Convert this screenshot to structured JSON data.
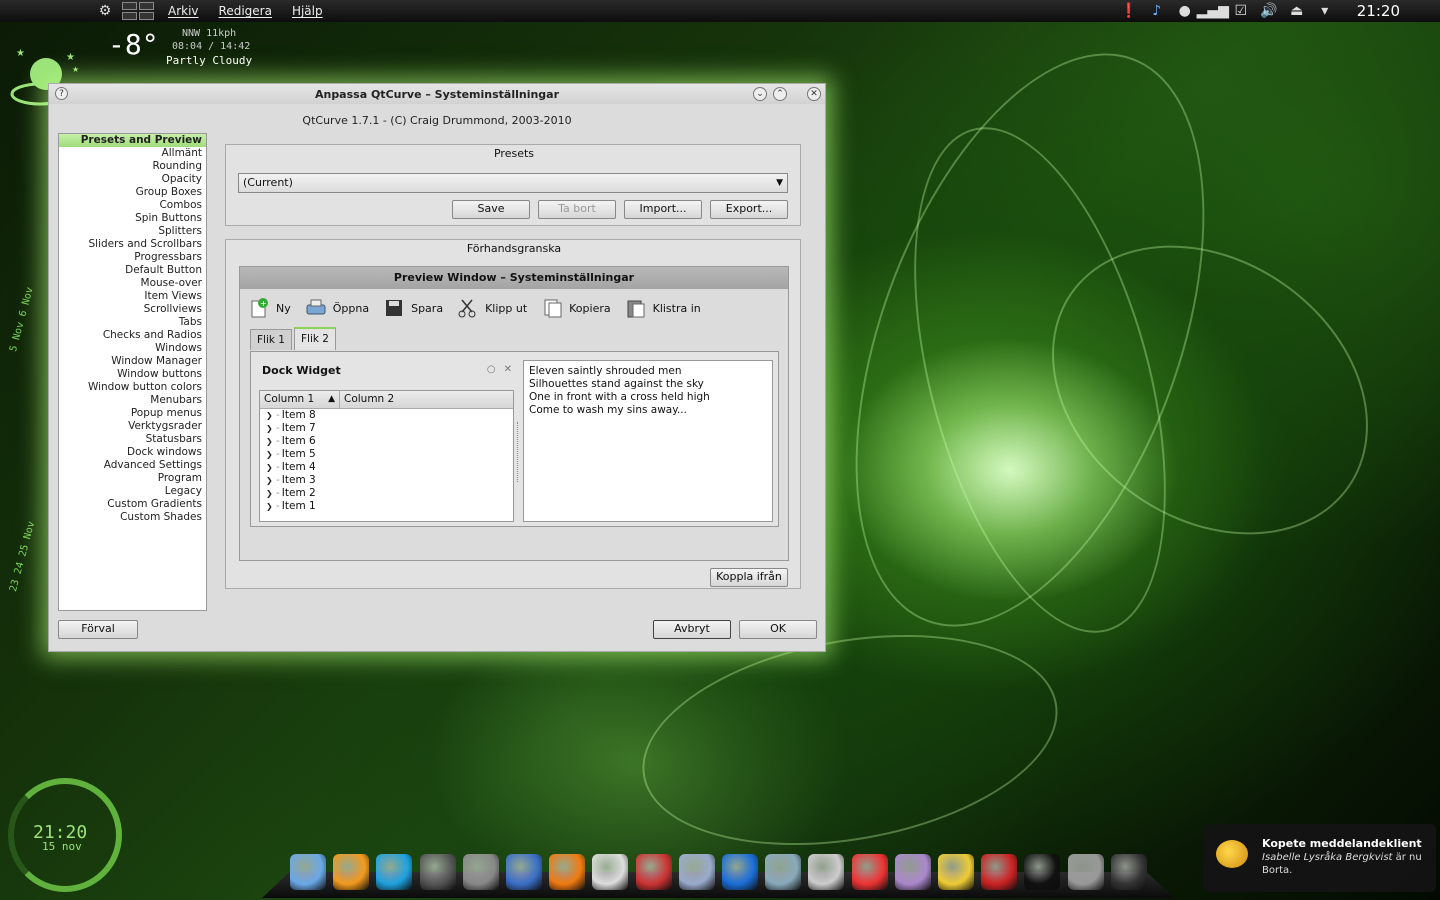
{
  "panel": {
    "menus": [
      "Arkiv",
      "Redigera",
      "Hjälp"
    ],
    "clock": "21:20",
    "tray_icons": [
      "alert-icon",
      "music-note-icon",
      "chat-bubble-icon",
      "signal-bars-icon",
      "checkbox-icon",
      "volume-icon",
      "eject-icon",
      "chevron-down-icon"
    ]
  },
  "weather": {
    "temp": "-8°",
    "wind": "NNW 11kph",
    "sun": "08:04 / 14:42",
    "condition": "Partly Cloudy"
  },
  "side_dates": {
    "top": "5 Nov  6 Nov",
    "bottom": "23 24 25 Nov"
  },
  "desktop_clock": {
    "time": "21:20",
    "date": "15 nov"
  },
  "window": {
    "title": "Anpassa QtCurve – Systeminställningar",
    "subtitle": "QtCurve 1.7.1 - (C) Craig Drummond, 2003-2010",
    "pages": [
      "Presets and Preview",
      "Allmänt",
      "Rounding",
      "Opacity",
      "Group Boxes",
      "Combos",
      "Spin Buttons",
      "Splitters",
      "Sliders and Scrollbars",
      "Progressbars",
      "Default Button",
      "Mouse-over",
      "Item Views",
      "Scrollviews",
      "Tabs",
      "Checks and Radios",
      "Windows",
      "Window Manager",
      "Window buttons",
      "Window button colors",
      "Menubars",
      "Popup menus",
      "Verktygsrader",
      "Statusbars",
      "Dock windows",
      "Advanced Settings",
      "Program",
      "Legacy",
      "Custom Gradients",
      "Custom Shades"
    ],
    "presets": {
      "label": "Presets",
      "current": "(Current)",
      "save": "Save",
      "delete": "Ta bort",
      "import": "Import...",
      "export": "Export..."
    },
    "preview": {
      "label": "Förhandsgranska",
      "window_title": "Preview Window – Systeminställningar",
      "toolbar": {
        "new": "Ny",
        "open": "Öppna",
        "save": "Spara",
        "cut": "Klipp ut",
        "copy": "Kopiera",
        "paste": "Klistra in"
      },
      "tabs": [
        "Flik 1",
        "Flik 2"
      ],
      "dock_title": "Dock Widget",
      "columns": [
        "Column 1",
        "Column 2"
      ],
      "items": [
        "Item 8",
        "Item 7",
        "Item 6",
        "Item 5",
        "Item 4",
        "Item 3",
        "Item 2",
        "Item 1"
      ],
      "text_lines": [
        "Eleven saintly shrouded men",
        "Silhouettes stand against the sky",
        "One in front with a cross held high",
        "Come to wash my sins away..."
      ],
      "detach": "Koppla ifrån"
    },
    "defaults": "Förval",
    "cancel": "Avbryt",
    "ok": "OK"
  },
  "notification": {
    "title": "Kopete meddelandeklient",
    "contact": "Isabelle Lysråka Bergkvist",
    "message": "är nu Borta."
  },
  "dock_icons": [
    "webcam-icon",
    "firefox-icon",
    "skype-icon",
    "music-player-icon",
    "aperture-icon",
    "browser-globe-icon",
    "office-icon",
    "document-icon",
    "pdf-viewer-icon",
    "screenshot-icon",
    "gp-icon",
    "image-viewer-icon",
    "disc-burner-icon",
    "snes-emulator-icon",
    "dots-icon",
    "game-icon",
    "gmail-icon",
    "terminal-icon",
    "tools-icon",
    "folder-icon"
  ],
  "colors": {
    "accent": "#8bd35a",
    "selection": "#a0dc7a"
  }
}
